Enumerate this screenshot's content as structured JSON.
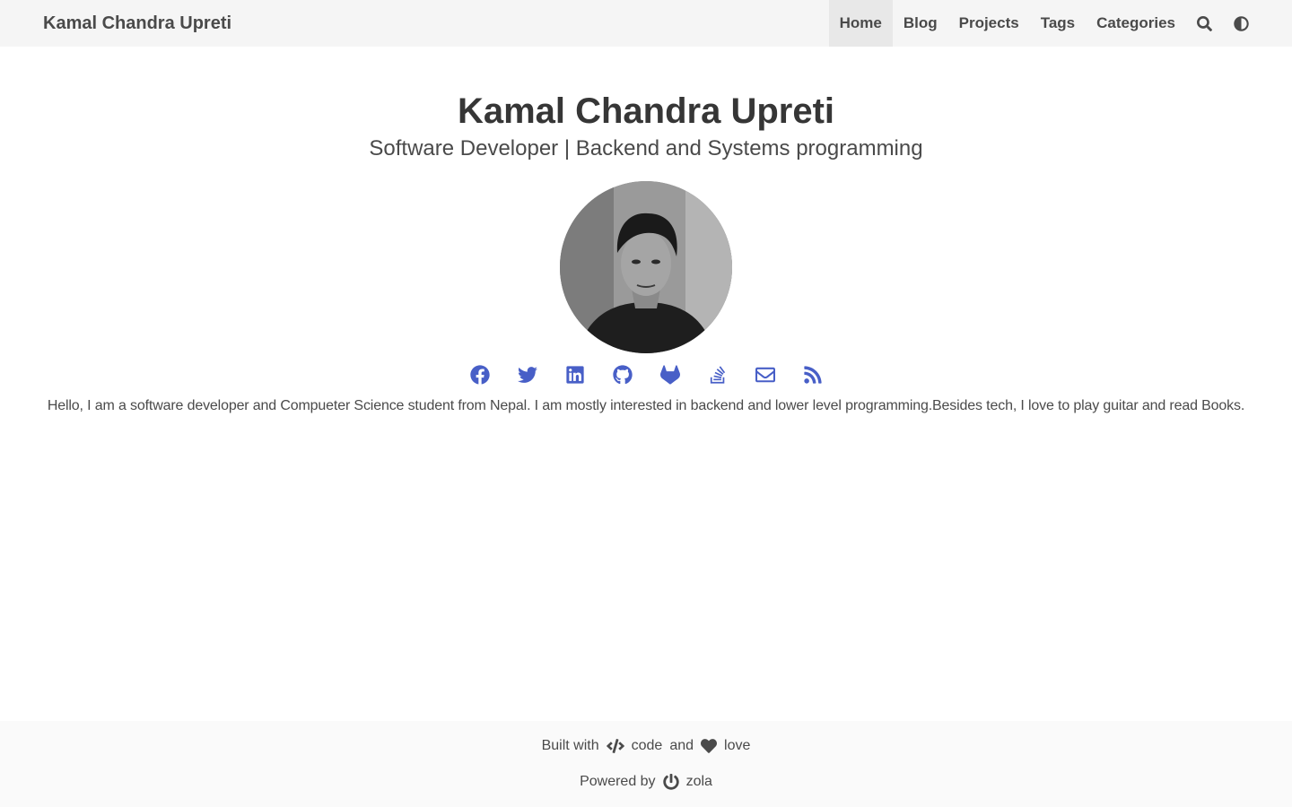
{
  "navbar": {
    "brand": "Kamal Chandra Upreti",
    "items": [
      {
        "label": "Home",
        "active": true
      },
      {
        "label": "Blog",
        "active": false
      },
      {
        "label": "Projects",
        "active": false
      },
      {
        "label": "Tags",
        "active": false
      },
      {
        "label": "Categories",
        "active": false
      }
    ],
    "icons": [
      "search-icon",
      "theme-toggle-icon"
    ]
  },
  "hero": {
    "title": "Kamal Chandra Upreti",
    "subtitle": "Software Developer | Backend and Systems programming",
    "avatar_icon": "profile-photo"
  },
  "social": [
    {
      "icon": "facebook-icon"
    },
    {
      "icon": "twitter-icon"
    },
    {
      "icon": "linkedin-icon"
    },
    {
      "icon": "github-icon"
    },
    {
      "icon": "gitlab-icon"
    },
    {
      "icon": "stackoverflow-icon"
    },
    {
      "icon": "email-icon"
    },
    {
      "icon": "rss-icon"
    }
  ],
  "bio": "Hello, I am a software developer and Compueter Science student from Nepal. I am mostly interested in backend and lower level programming.Besides tech, I love to play guitar and read Books.",
  "footer": {
    "built_prefix": "Built with",
    "code_label": "code",
    "and_label": "and",
    "love_label": "love",
    "powered_prefix": "Powered by",
    "powered_name": "zola"
  },
  "colors": {
    "navbar_bg": "#f5f5f5",
    "active_item_bg": "#e8e8e8",
    "link_blue": "#485fc7",
    "text": "#363636",
    "footer_bg": "#fafafa"
  }
}
